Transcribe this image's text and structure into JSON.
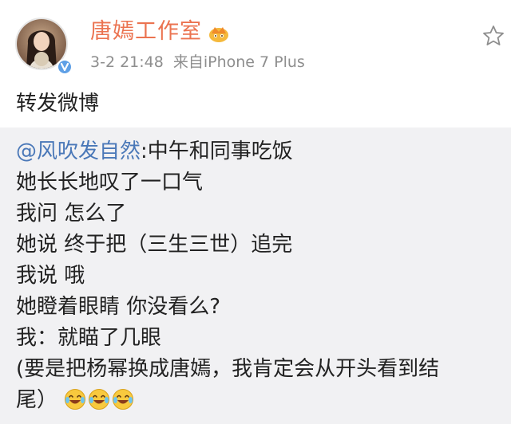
{
  "header": {
    "user_name": "唐嫣工作室",
    "timestamp": "3-2 21:48",
    "source": "来自iPhone 7 Plus",
    "crown_icon": "crown-icon",
    "verified_icon": "verified-badge-icon",
    "favorite_icon": "star-icon"
  },
  "post": {
    "text": "转发微博"
  },
  "repost": {
    "mention": "@风吹发自然",
    "first_line_rest": ":中午和同事吃饭",
    "lines": [
      "她长长地叹了一口气",
      "我问 怎么了",
      "她说 终于把（三生三世）追完",
      "我说 哦",
      "她瞪着眼睛 你没看么?",
      "我：就瞄了几眼",
      "(要是把杨幂换成唐嫣，我肯定会从开头看到结",
      "尾）"
    ],
    "trailing_emoji": [
      "laugh-cry-emoji",
      "laugh-cry-emoji",
      "laugh-cry-emoji"
    ]
  },
  "colors": {
    "name": "#eb7350",
    "meta": "#8e8e8e",
    "mention": "#4a78b8",
    "repost_bg": "#f1f1f3",
    "text": "#222222"
  }
}
